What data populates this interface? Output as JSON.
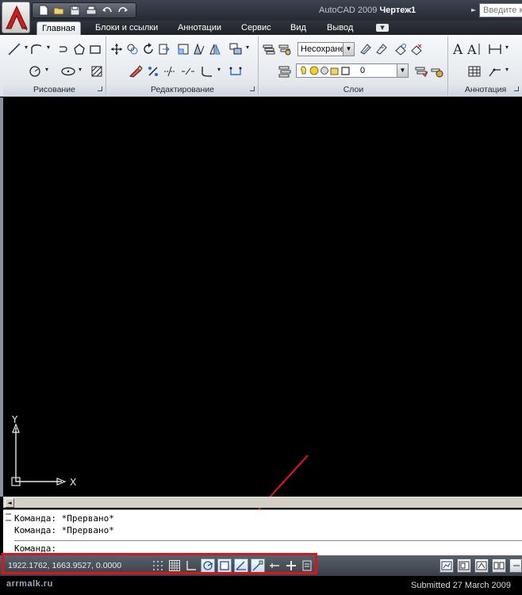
{
  "app": {
    "title_prefix": "AutoCAD 2009",
    "document": "Чертеж1",
    "search_placeholder": "Введите к"
  },
  "tabs": [
    "Главная",
    "Блоки и ссылки",
    "Аннотации",
    "Сервис",
    "Вид",
    "Вывод"
  ],
  "panels": {
    "draw": "Рисование",
    "modify": "Редактирование",
    "layers": "Слои",
    "annotation": "Аннотация"
  },
  "layers": {
    "state_combo": "Несохране",
    "current_layer": "0"
  },
  "ucs": {
    "y_label": "Y",
    "x_label": "X"
  },
  "command_lines": [
    "Команда: *Прервано*",
    "Команда: *Прервано*",
    "Команда:"
  ],
  "status": {
    "coordinates": "1922.1762, 1663.9527, 0.0000"
  },
  "footer": {
    "site": "arrmalk.ru",
    "submitted": "Submitted 27 March 2009"
  },
  "colors": {
    "highlight": "#d7171c",
    "arrow": "#e2191f",
    "logo_red": "#c8201f"
  }
}
